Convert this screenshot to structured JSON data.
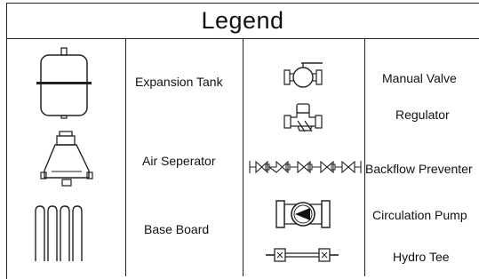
{
  "legend": {
    "title": "Legend",
    "left_items": [
      {
        "label": "Expansion Tank",
        "icon": "expansion-tank-icon"
      },
      {
        "label": "Air Seperator",
        "icon": "air-separator-icon"
      },
      {
        "label": "Base Board",
        "icon": "baseboard-icon"
      }
    ],
    "right_items": [
      {
        "label": "Manual Valve",
        "icon": "manual-valve-icon"
      },
      {
        "label": "Regulator",
        "icon": "regulator-icon"
      },
      {
        "label": "Backflow Preventer",
        "icon": "backflow-preventer-icon"
      },
      {
        "label": "Circulation Pump",
        "icon": "circulation-pump-icon"
      },
      {
        "label": "Hydro Tee",
        "icon": "hydro-tee-icon"
      }
    ]
  }
}
